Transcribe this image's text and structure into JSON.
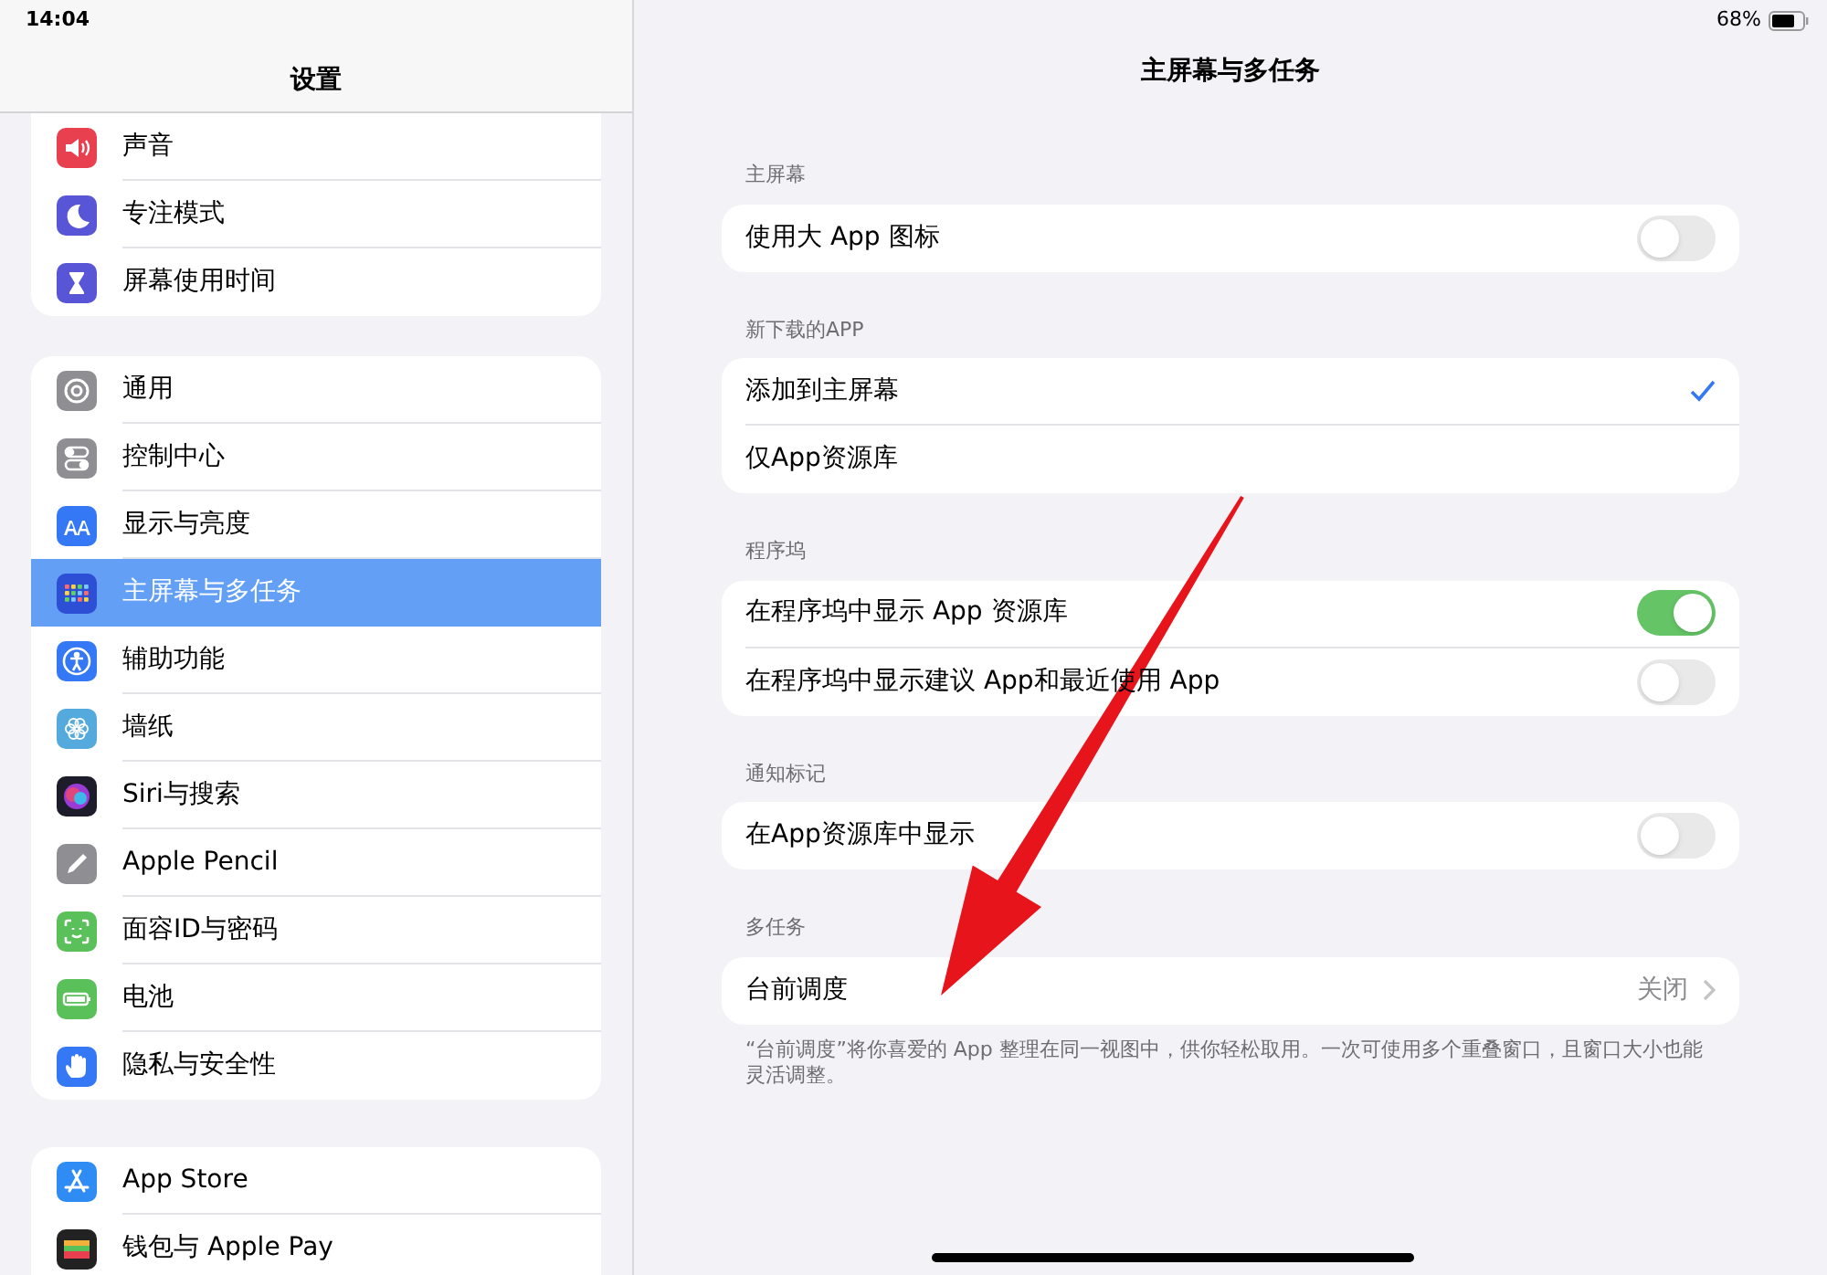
{
  "status_bar": {
    "time": "14:04",
    "battery": "68%"
  },
  "sidebar": {
    "title": "设置",
    "groups": [
      {
        "items": [
          {
            "label": "声音",
            "kind": "sound",
            "color": "#e9404f",
            "selected": false
          },
          {
            "label": "专注模式",
            "kind": "moon",
            "color": "#5856d6",
            "selected": false
          },
          {
            "label": "屏幕使用时间",
            "kind": "hourglass",
            "color": "#5856d6",
            "selected": false
          }
        ]
      },
      {
        "items": [
          {
            "label": "通用",
            "kind": "gear",
            "color": "#8e8e93",
            "selected": false
          },
          {
            "label": "控制中心",
            "kind": "switches",
            "color": "#8e8e93",
            "selected": false
          },
          {
            "label": "显示与亮度",
            "kind": "text",
            "color": "#3478f6",
            "selected": false
          },
          {
            "label": "主屏幕与多任务",
            "kind": "grid",
            "color": "#2c4fd6",
            "selected": true
          },
          {
            "label": "辅助功能",
            "kind": "person",
            "color": "#3478f6",
            "selected": false
          },
          {
            "label": "墙纸",
            "kind": "flower",
            "color": "#54a9dd",
            "selected": false
          },
          {
            "label": "Siri与搜索",
            "kind": "orb",
            "color": "#1c1c2a",
            "selected": false
          },
          {
            "label": "Apple Pencil",
            "kind": "pencil",
            "color": "#8e8e93",
            "selected": false
          },
          {
            "label": "面容ID与密码",
            "kind": "face",
            "color": "#5ac05a",
            "selected": false
          },
          {
            "label": "电池",
            "kind": "battery",
            "color": "#5ac05a",
            "selected": false
          },
          {
            "label": "隐私与安全性",
            "kind": "hand",
            "color": "#3478f6",
            "selected": false
          }
        ]
      },
      {
        "items": [
          {
            "label": "App Store",
            "kind": "store",
            "color": "#2f8cf4",
            "selected": false
          },
          {
            "label": "钱包与 Apple Pay",
            "kind": "wallet",
            "color": "#222222",
            "selected": false
          }
        ]
      }
    ]
  },
  "detail": {
    "title": "主屏幕与多任务",
    "sections": [
      {
        "header": "主屏幕",
        "rows": [
          {
            "kind": "toggle",
            "label": "使用大 App 图标",
            "on": false
          }
        ]
      },
      {
        "header": "新下载的APP",
        "rows": [
          {
            "kind": "check",
            "label": "添加到主屏幕",
            "selected": true
          },
          {
            "kind": "check",
            "label": "仅App资源库",
            "selected": false
          }
        ]
      },
      {
        "header": "程序坞",
        "rows": [
          {
            "kind": "toggle",
            "label": "在程序坞中显示 App 资源库",
            "on": true
          },
          {
            "kind": "toggle",
            "label": "在程序坞中显示建议 App和最近使用 App",
            "on": false
          }
        ]
      },
      {
        "header": "通知标记",
        "rows": [
          {
            "kind": "toggle",
            "label": "在App资源库中显示",
            "on": false
          }
        ]
      },
      {
        "header": "多任务",
        "rows": [
          {
            "kind": "link",
            "label": "台前调度",
            "value": "关闭"
          }
        ],
        "footer": "“台前调度”将你喜爱的 App 整理在同一视图中，供你轻松取用。一次可使用多个重叠窗口，且窗口大小也能灵活调整。"
      }
    ]
  }
}
